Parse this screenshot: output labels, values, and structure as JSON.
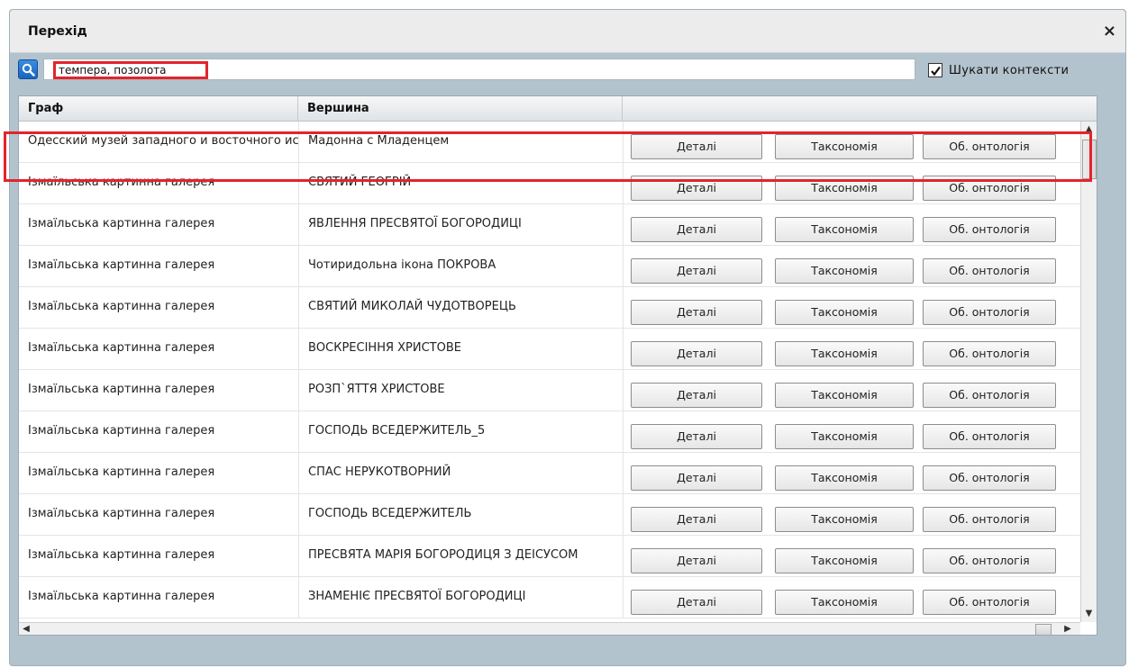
{
  "window": {
    "title": "Перехід",
    "close_glyph": "×"
  },
  "search": {
    "value": "темпера, позолота",
    "icon": "search-icon"
  },
  "context_search": {
    "label": "Шукати контексти",
    "checked": true
  },
  "grid": {
    "columns": [
      "Граф",
      "Вершина",
      ""
    ],
    "buttons": {
      "details": "Деталі",
      "taxonomy": "Таксономія",
      "ontology": "Об. онтологія"
    },
    "rows": [
      {
        "graph": "Одесский музей западного и восточного искусства",
        "vertex": "Мадонна с Младенцем"
      },
      {
        "graph": "Ізмаїльська картинна галерея",
        "vertex": "СВЯТИЙ ГЕОГРІЙ"
      },
      {
        "graph": "Ізмаїльська картинна галерея",
        "vertex": "ЯВЛЕННЯ ПРЕСВЯТОЇ БОГОРОДИЦІ"
      },
      {
        "graph": "Ізмаїльська картинна галерея",
        "vertex": "Чотиридольна ікона ПОКРОВА"
      },
      {
        "graph": "Ізмаїльська картинна галерея",
        "vertex": "СВЯТИЙ МИКОЛАЙ ЧУДОТВОРЕЦЬ"
      },
      {
        "graph": "Ізмаїльська картинна галерея",
        "vertex": "ВОСКРЕСІННЯ ХРИСТОВЕ"
      },
      {
        "graph": "Ізмаїльська картинна галерея",
        "vertex": "РОЗП`ЯТТЯ ХРИСТОВЕ"
      },
      {
        "graph": "Ізмаїльська картинна галерея",
        "vertex": "ГОСПОДЬ ВСЕДЕРЖИТЕЛЬ_5"
      },
      {
        "graph": "Ізмаїльська картинна галерея",
        "vertex": "СПАС НЕРУКОТВОРНИЙ"
      },
      {
        "graph": "Ізмаїльська картинна галерея",
        "vertex": "ГОСПОДЬ ВСЕДЕРЖИТЕЛЬ"
      },
      {
        "graph": "Ізмаїльська картинна галерея",
        "vertex": "ПРЕСВЯТА МАРІЯ БОГОРОДИЦЯ З ДЕІСУСОМ"
      },
      {
        "graph": "Ізмаїльська картинна галерея",
        "vertex": "ЗНАМЕНІЄ ПРЕСВЯТОЇ БОГОРОДИЦІ"
      }
    ]
  },
  "colors": {
    "accent": "#1765c0",
    "highlight": "#e3242b",
    "frame": "#b3c3cd"
  }
}
